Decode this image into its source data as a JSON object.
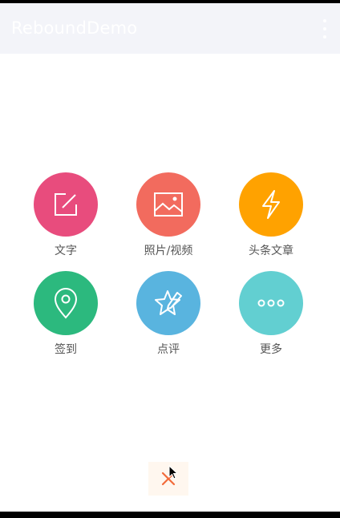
{
  "app_bar": {
    "title": "ReboundDemo",
    "menu_icon": "more-vert-icon"
  },
  "menu_items": [
    {
      "label": "文字",
      "icon": "compose-icon",
      "color": "#e84c7d"
    },
    {
      "label": "照片/视频",
      "icon": "image-icon",
      "color": "#f26b5e"
    },
    {
      "label": "头条文章",
      "icon": "lightning-icon",
      "color": "#ffa200"
    },
    {
      "label": "签到",
      "icon": "location-pin-icon",
      "color": "#2cb97e"
    },
    {
      "label": "点评",
      "icon": "star-pen-icon",
      "color": "#59b4df"
    },
    {
      "label": "更多",
      "icon": "more-dots-icon",
      "color": "#62cfd1"
    }
  ],
  "close_button": {
    "icon": "close-icon",
    "color": "#f26b3b"
  }
}
